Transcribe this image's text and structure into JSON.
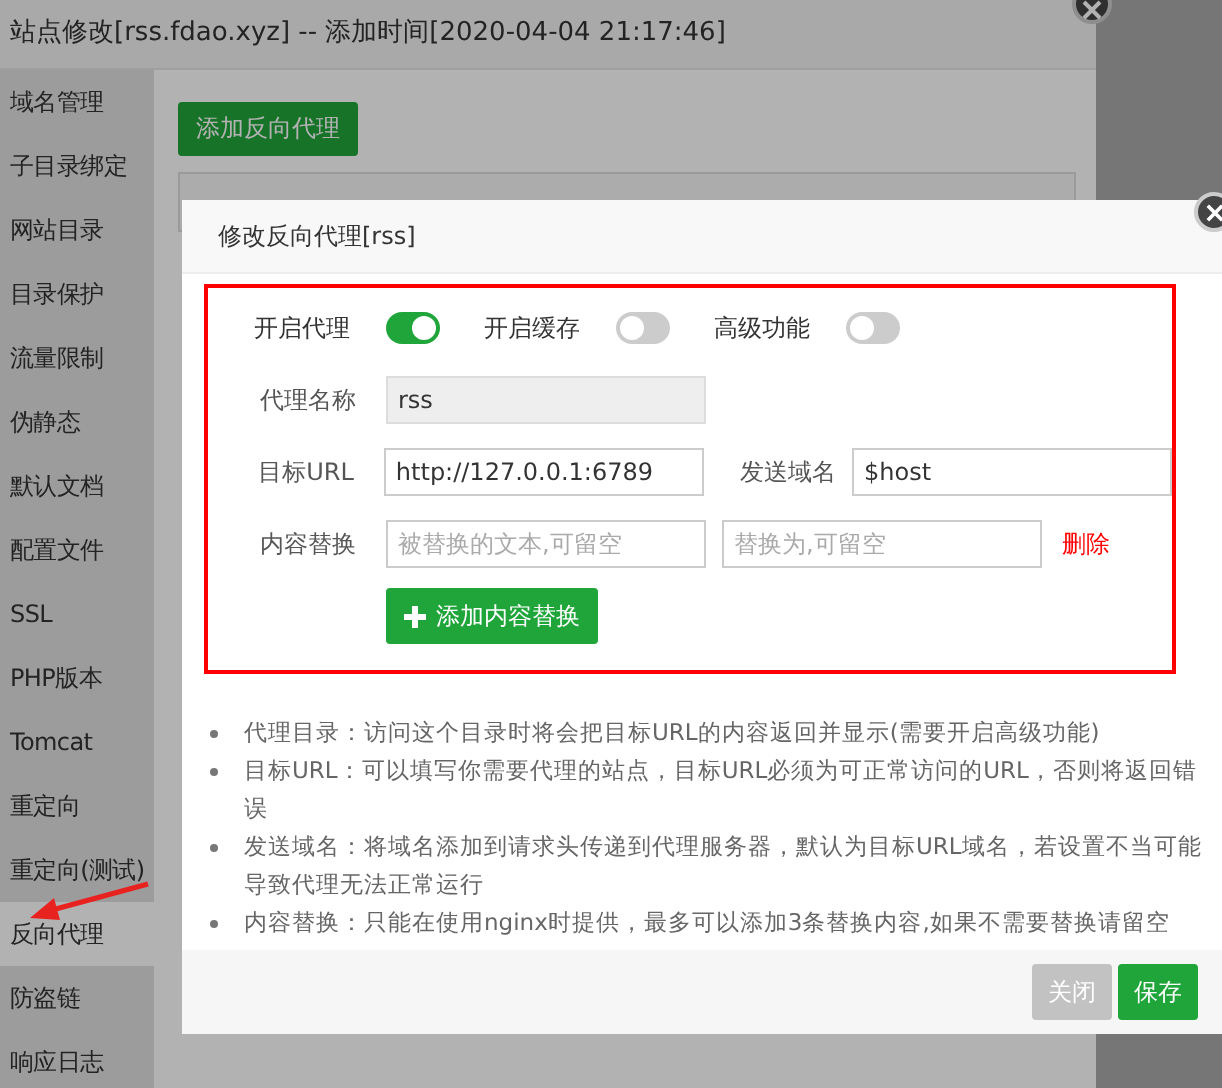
{
  "window": {
    "title": "站点修改[rss.fdao.xyz] -- 添加时间[2020-04-04 21:17:46]"
  },
  "sidebar": {
    "items": [
      {
        "label": "域名管理",
        "selected": false
      },
      {
        "label": "子目录绑定",
        "selected": false
      },
      {
        "label": "网站目录",
        "selected": false
      },
      {
        "label": "目录保护",
        "selected": false
      },
      {
        "label": "流量限制",
        "selected": false
      },
      {
        "label": "伪静态",
        "selected": false
      },
      {
        "label": "默认文档",
        "selected": false
      },
      {
        "label": "配置文件",
        "selected": false
      },
      {
        "label": "SSL",
        "selected": false
      },
      {
        "label": "PHP版本",
        "selected": false
      },
      {
        "label": "Tomcat",
        "selected": false
      },
      {
        "label": "重定向",
        "selected": false
      },
      {
        "label": "重定向(测试)",
        "selected": false
      },
      {
        "label": "反向代理",
        "selected": true
      },
      {
        "label": "防盗链",
        "selected": false
      },
      {
        "label": "响应日志",
        "selected": false
      }
    ]
  },
  "content": {
    "add_button": "添加反向代理"
  },
  "dialog": {
    "title": "修改反向代理[rss]",
    "toggles": [
      {
        "label": "开启代理",
        "on": true
      },
      {
        "label": "开启缓存",
        "on": false
      },
      {
        "label": "高级功能",
        "on": false
      }
    ],
    "name_field": {
      "label": "代理名称",
      "value": "rss",
      "disabled": true
    },
    "target_field": {
      "label": "目标URL",
      "value": "http://127.0.0.1:6789"
    },
    "host_field": {
      "label": "发送域名",
      "value": "$host"
    },
    "replace_row": {
      "label": "内容替换",
      "from_placeholder": "被替换的文本,可留空",
      "to_placeholder": "替换为,可留空",
      "delete_link": "删除"
    },
    "add_replace_button": "添加内容替换",
    "notes": [
      "代理目录：访问这个目录时将会把目标URL的内容返回并显示(需要开启高级功能)",
      "目标URL：可以填写你需要代理的站点，目标URL必须为可正常访问的URL，否则将返回错误",
      "发送域名：将域名添加到请求头传递到代理服务器，默认为目标URL域名，若设置不当可能导致代理无法正常运行",
      "内容替换：只能在使用nginx时提供，最多可以添加3条替换内容,如果不需要替换请留空"
    ],
    "buttons": [
      {
        "label": "关闭",
        "kind": "secondary"
      },
      {
        "label": "保存",
        "kind": "primary"
      }
    ]
  }
}
